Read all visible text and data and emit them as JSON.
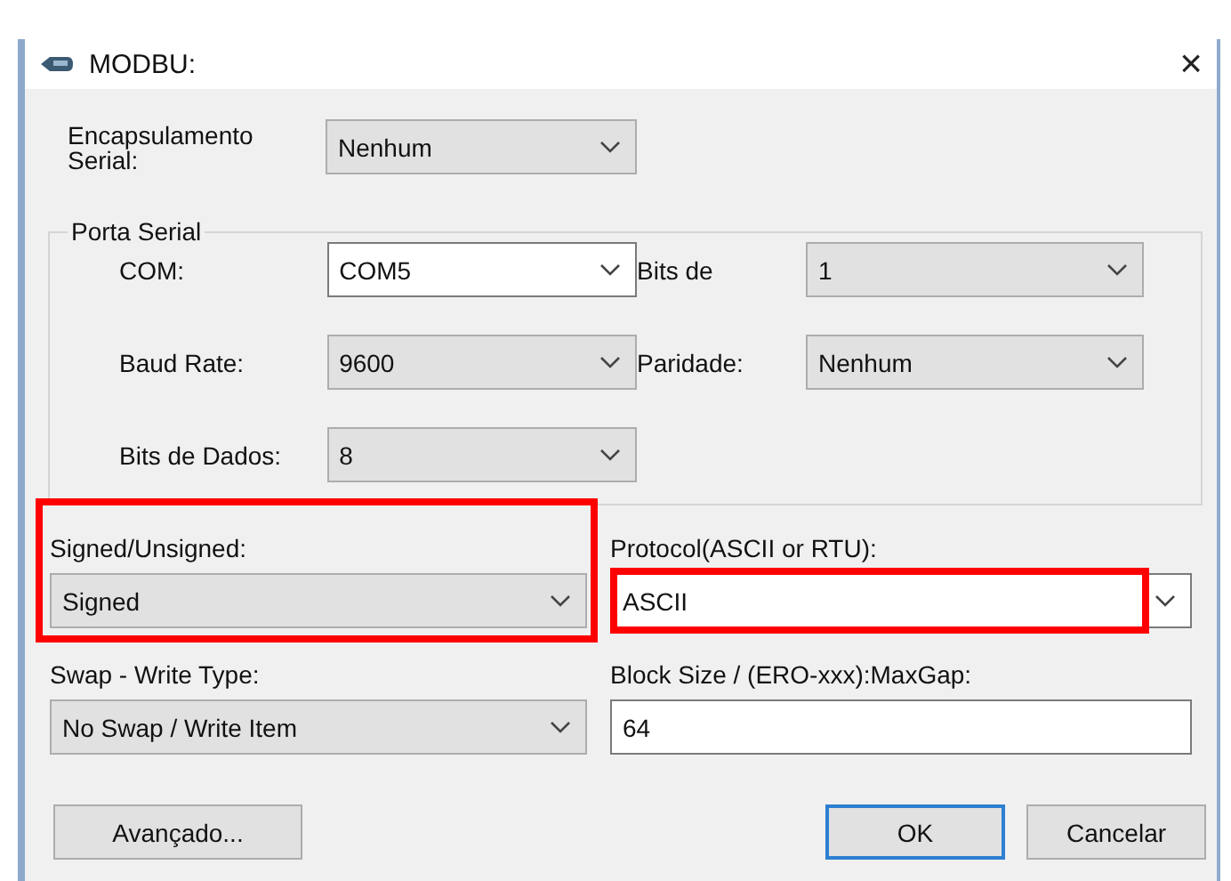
{
  "window": {
    "title": "MODBU:",
    "close": "×"
  },
  "encapsulation": {
    "label": "Encapsulamento Serial:",
    "value": "Nenhum",
    "kind": "list"
  },
  "serial_port": {
    "title": "Porta Serial",
    "fields": [
      {
        "label": "COM:",
        "value": "COM5",
        "kind": "editable"
      },
      {
        "label": "Bits de",
        "value": "1",
        "kind": "list"
      },
      {
        "label": "Baud Rate:",
        "value": "9600",
        "kind": "list"
      },
      {
        "label": "Paridade:",
        "value": "Nenhum",
        "kind": "list"
      },
      {
        "label": "Bits de Dados:",
        "value": "8",
        "kind": "list"
      }
    ]
  },
  "options": [
    {
      "label": "Signed/Unsigned:",
      "value": "Signed",
      "kind": "list",
      "highlighted": true
    },
    {
      "label": "Protocol(ASCII or RTU):",
      "value": "ASCII",
      "kind": "editable",
      "highlighted": true
    },
    {
      "label": "Swap - Write Type:",
      "value": "No Swap / Write Item",
      "kind": "list",
      "highlighted": false
    },
    {
      "label": "Block Size / (ERO-xxx):MaxGap:",
      "value": "64",
      "kind": "text",
      "highlighted": false
    }
  ],
  "buttons": [
    {
      "label": "Avançado...",
      "default": false
    },
    {
      "label": "OK",
      "default": true
    },
    {
      "label": "Cancelar",
      "default": false
    }
  ]
}
